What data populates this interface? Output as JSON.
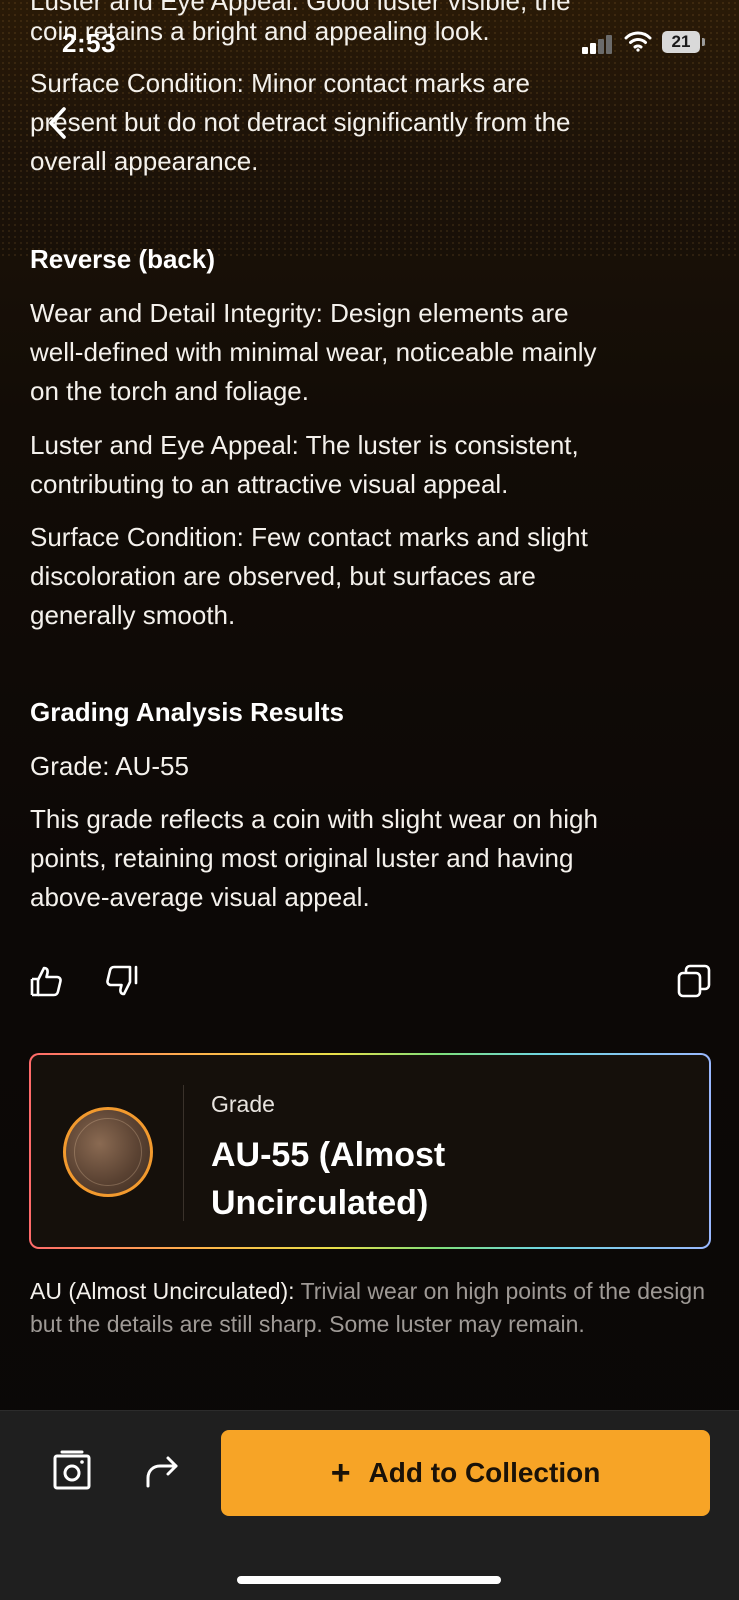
{
  "status_bar": {
    "time": "2:53",
    "battery": "21"
  },
  "obverse_tail": {
    "cut_line_1": "Luster and Eye Appeal: Good luster visible, the",
    "cut_line_2": "coin retains a bright and appealing look.",
    "surface_line_1": "Surface Condition: Minor contact marks are",
    "surface_line_2": "present but do not detract significantly from the",
    "surface_line_3": "overall appearance."
  },
  "reverse": {
    "heading": "Reverse (back)",
    "wear_1": "Wear and Detail Integrity: Design elements are",
    "wear_2": "well-defined with minimal wear, noticeable mainly",
    "wear_3": "on the torch and foliage.",
    "luster_1": "Luster and Eye Appeal: The luster is consistent,",
    "luster_2": "contributing to an attractive visual appeal.",
    "surface_1": "Surface Condition: Few contact marks and slight",
    "surface_2": "discoloration are observed, but surfaces are",
    "surface_3": "generally smooth."
  },
  "results": {
    "heading": "Grading Analysis Results",
    "grade_line": "Grade: AU-55",
    "desc_1": "This grade reflects a coin with slight wear on high",
    "desc_2": "points, retaining most original luster and having",
    "desc_3": "above-average visual appeal."
  },
  "icons": {
    "thumbs_up": "thumbs-up-icon",
    "thumbs_down": "thumbs-down-icon",
    "copy": "copy-icon",
    "camera": "camera-icon",
    "share": "share-icon"
  },
  "grade_card": {
    "label": "Grade",
    "value_line_1": "AU-55 (Almost",
    "value_line_2": "Uncirculated)",
    "border_colors": [
      "#ff6a6a",
      "#ffb44a",
      "#e8e04a",
      "#7fe07a",
      "#6fd6e0",
      "#9ab8ff"
    ]
  },
  "note": {
    "term": "AU (Almost Uncirculated):",
    "text": "Trivial wear on high points of the design but the details are still sharp. Some luster may remain."
  },
  "bottom_bar": {
    "add_label": "Add to Collection",
    "add_color": "#f7a426"
  }
}
